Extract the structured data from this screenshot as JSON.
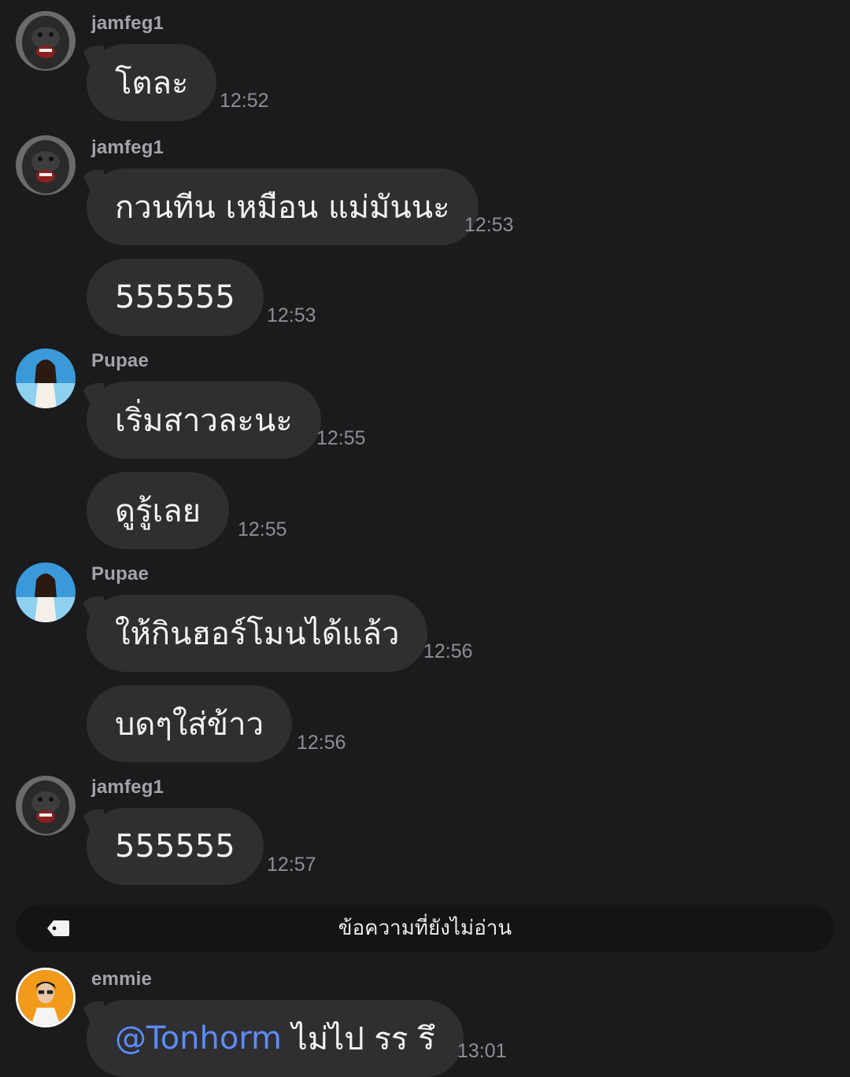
{
  "messages": [
    {
      "sender": "jamfeg1",
      "text": "โตละ",
      "time": "12:52"
    },
    {
      "text": "กวนทีน เหมือน แม่มันนะ",
      "time": "12:53",
      "sender": "jamfeg1"
    },
    {
      "text": "555555",
      "time": "12:53"
    },
    {
      "sender": "Pupae",
      "text": "เริ่มสาวละนะ",
      "time": "12:55"
    },
    {
      "text": "ดูรู้เลย",
      "time": "12:55"
    },
    {
      "sender": "Pupae",
      "text": "ให้กินฮอร์โมนได้แล้ว",
      "time": "12:56"
    },
    {
      "text": "บดๆใส่ข้าว",
      "time": "12:56"
    },
    {
      "sender": "jamfeg1",
      "text": "555555",
      "time": "12:57"
    }
  ],
  "unread_divider": {
    "label": "ข้อความที่ยังไม่อ่าน",
    "icon": "tag-icon"
  },
  "last_message": {
    "sender": "emmie",
    "mention": "@Tonhorm",
    "text": " ไม่ไป รร รึ",
    "time": "13:01"
  },
  "colors": {
    "background": "#1b1b1d",
    "bubble": "#2f2f31",
    "mention": "#5b8cff",
    "sender": "#a3a3a8",
    "time": "#8e8e93"
  }
}
